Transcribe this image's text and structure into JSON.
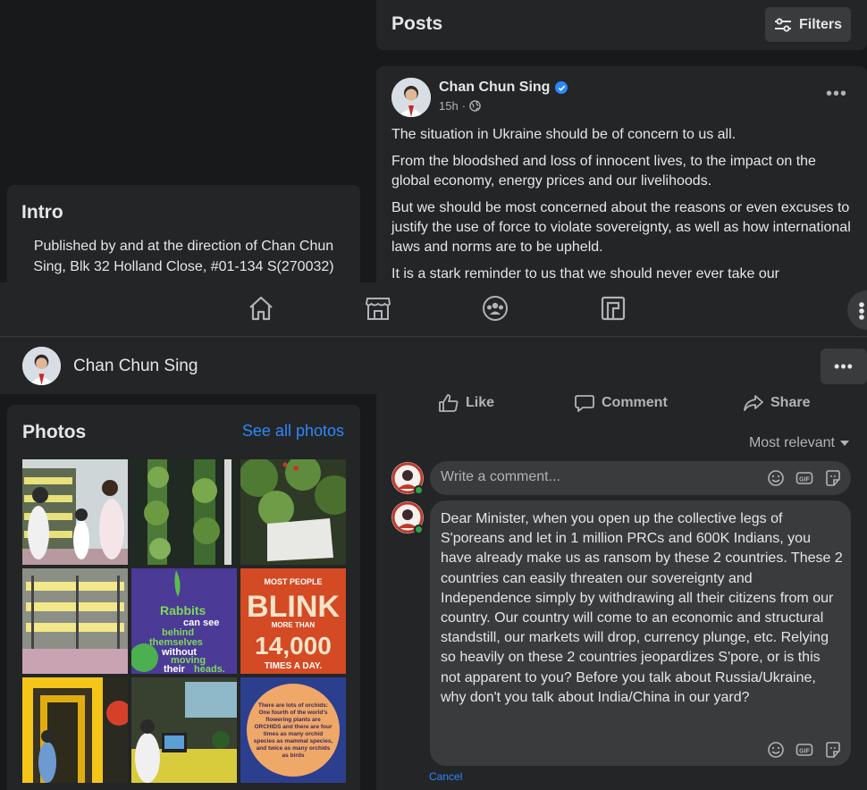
{
  "posts_header": {
    "title": "Posts",
    "filters_label": "Filters"
  },
  "post": {
    "author": "Chan Chun Sing",
    "time": "15h",
    "paragraphs": [
      "The situation in Ukraine should be of concern to us all.",
      "From the bloodshed and loss of innocent lives, to the impact on the global economy, energy prices and our livelihoods.",
      "But we should be most concerned about the reasons or even excuses to justify the use of force to violate sovereignty, as well as how international laws and norms are to be upheld.",
      "It is a stark reminder to us that we should never ever take our"
    ]
  },
  "intro": {
    "title": "Intro",
    "text": "Published by and at the direction of Chan Chun Sing, Blk 32 Holland Close, #01-134 S(270032)"
  },
  "navbar": {
    "icons": [
      "home-icon",
      "marketplace-icon",
      "groups-icon",
      "gaming-icon",
      "menu-grid-icon"
    ]
  },
  "profile_strip": {
    "name": "Chan Chun Sing",
    "more": "•••"
  },
  "photos": {
    "title": "Photos",
    "see_all": "See all photos",
    "overlay_texts": {
      "rabbits": [
        "Rabbits",
        "can see",
        "behind",
        "themselves",
        "without",
        "moving",
        "their",
        "heads."
      ],
      "blink_top": "MOST PEOPLE",
      "blink_main": "BLINK",
      "blink_more": "MORE THAN",
      "blink_number": "14,000",
      "blink_bottom": "TIMES A DAY.",
      "orchid": "There are lots of orchids: One fourth of the world's flowering plants are ORCHIDS and there are four times as many orchid species as mammal species, and twice as many orchids as birds"
    }
  },
  "actions": {
    "like": "Like",
    "comment": "Comment",
    "share": "Share"
  },
  "sort": {
    "label": "Most relevant"
  },
  "composer": {
    "placeholder": "Write a comment..."
  },
  "reply": {
    "text": "Dear Minister, when you open up the collective legs of S'poreans and let in 1 million PRCs and 600K Indians, you have already make us as ransom by these 2 countries. These 2 countries can easily threaten our sovereignty and Independence simply by withdrawing all their citizens from our country. Our country will come to an economic and structural standstill, our markets will drop, currency plunge, etc. Relying so heavily on these 2 countries jeopardizes S'pore, or is this not apparent to you? Before you talk about Russia/Ukraine, why don't you talk about India/China in our yard?",
    "cancel": "Cancel"
  },
  "colors": {
    "background": "#18191a",
    "card": "#242526",
    "accent": "#2d88ff",
    "muted": "#b0b3b8",
    "online": "#31a24c"
  }
}
